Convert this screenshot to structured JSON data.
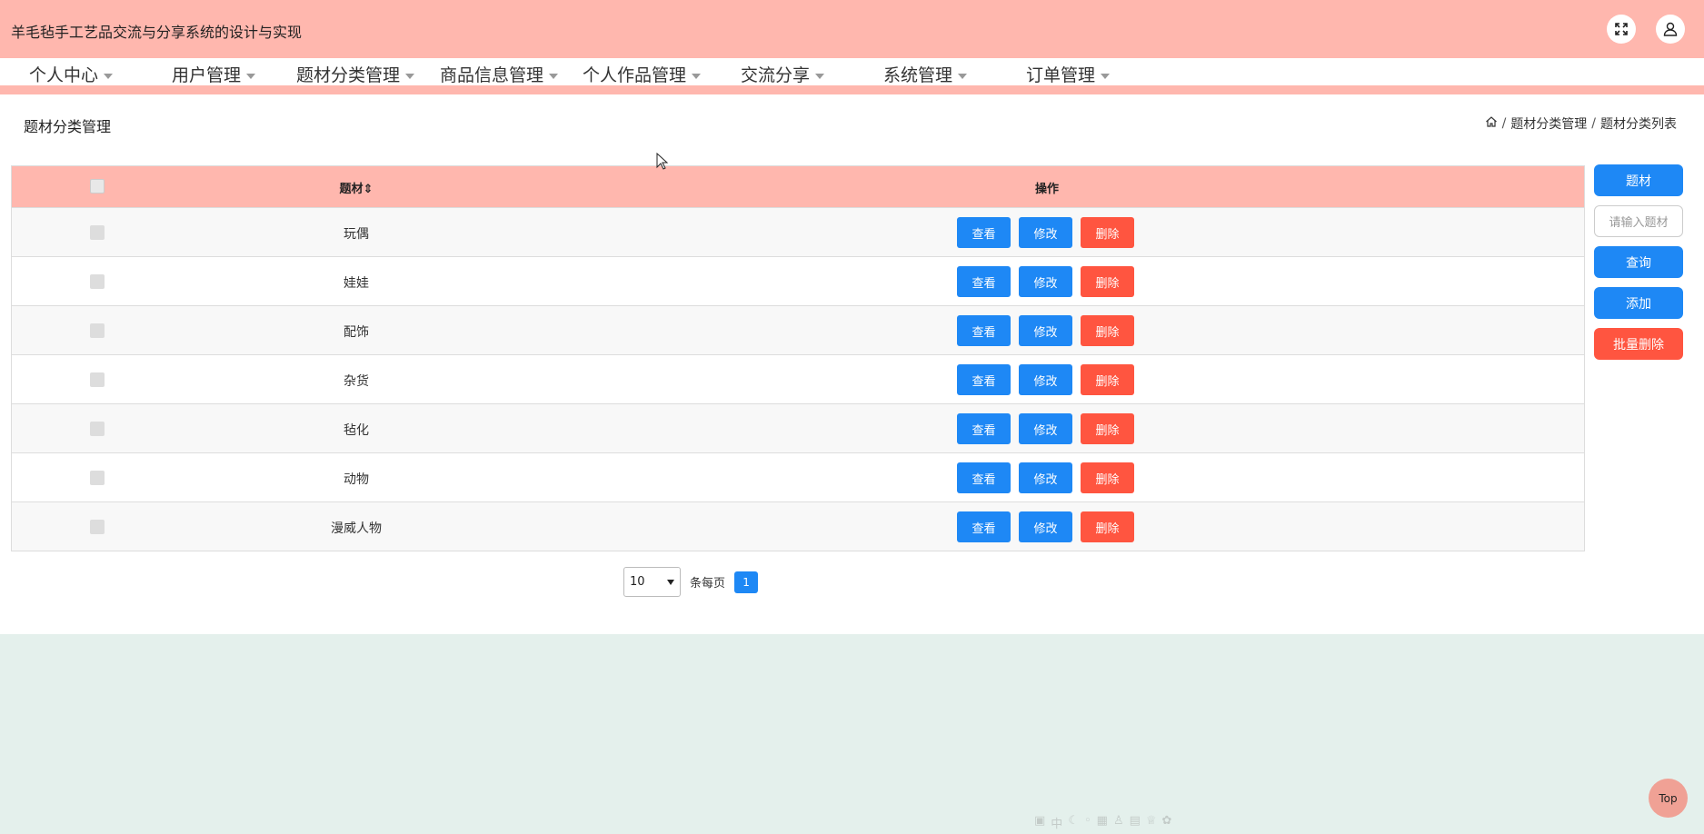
{
  "app": {
    "title": "羊毛毡手工艺品交流与分享系统的设计与实现"
  },
  "nav": {
    "items": [
      {
        "label": "个人中心"
      },
      {
        "label": "用户管理"
      },
      {
        "label": "题材分类管理"
      },
      {
        "label": "商品信息管理"
      },
      {
        "label": "个人作品管理"
      },
      {
        "label": "交流分享"
      },
      {
        "label": "系统管理"
      },
      {
        "label": "订单管理"
      }
    ]
  },
  "page": {
    "title": "题材分类管理",
    "breadcrumb": [
      "题材分类管理",
      "题材分类列表"
    ]
  },
  "table": {
    "headers": {
      "name": "题材",
      "sort_glyph": "⇕",
      "ops": "操作"
    },
    "rows": [
      "玩偶",
      "娃娃",
      "配饰",
      "杂货",
      "毡化",
      "动物",
      "漫威人物"
    ],
    "actions": {
      "view": "查看",
      "edit": "修改",
      "delete": "删除"
    }
  },
  "sidebar": {
    "label_button": "题材",
    "search_placeholder": "请输入题材",
    "query_button": "查询",
    "add_button": "添加",
    "batch_delete_button": "批量删除"
  },
  "pagination": {
    "page_size": "10",
    "per_page_label": "条每页",
    "current_page": "1"
  },
  "top_button": "Top",
  "ime_toolbar": [
    "中"
  ],
  "colors": {
    "header_bg": "#ffb7ae",
    "primary": "#1e88f5",
    "danger": "#ff5540",
    "page_bg": "#e4f0ec"
  }
}
